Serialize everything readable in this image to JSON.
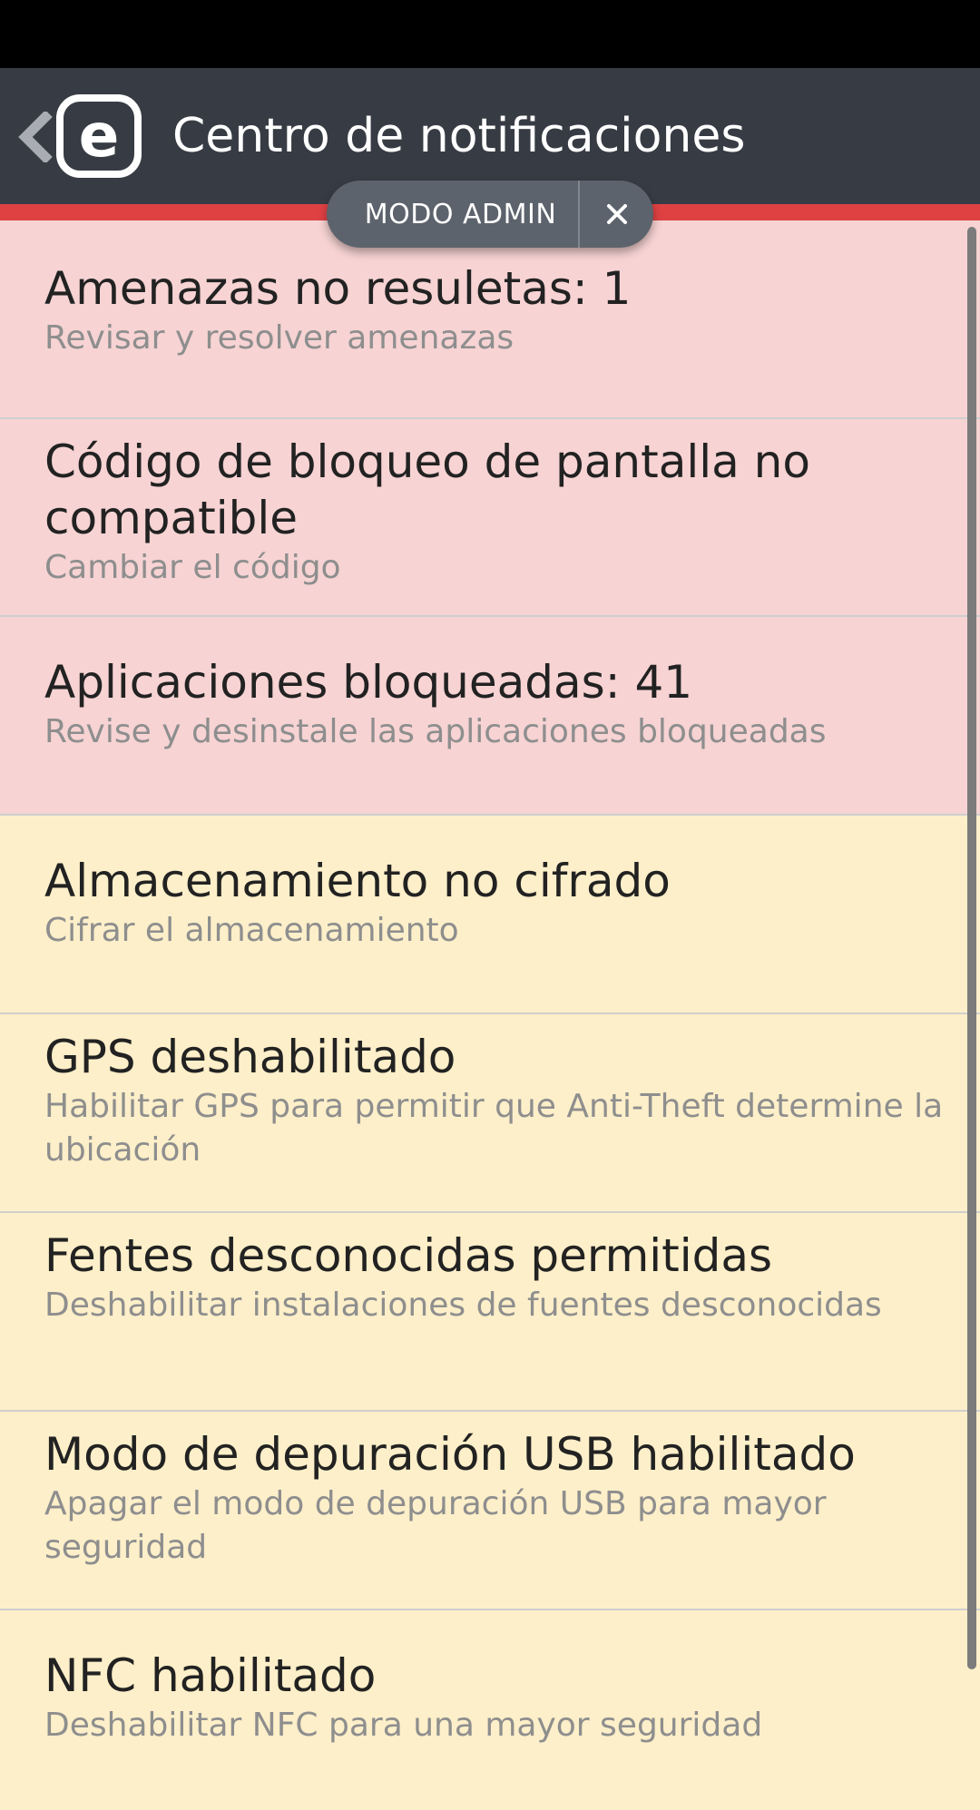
{
  "app_bar": {
    "title": "Centro de notificaciones",
    "back_icon": "chevron-left-icon",
    "logo_icon": "eset-e-logo-icon"
  },
  "admin_mode": {
    "label": "MODO ADMIN",
    "close_icon": "close-icon"
  },
  "colors": {
    "app_bar": "#373c44",
    "alert_strip": "#df4143",
    "critical_bg": "#f7d3d3",
    "warning_bg": "#fdefc9"
  },
  "notifications": [
    {
      "title": "Amenazas no resuletas: 1",
      "subtitle": "Revisar y resolver amenazas",
      "severity": "critical"
    },
    {
      "title": "Código de bloqueo de pantalla no compatible",
      "subtitle": "Cambiar el código",
      "severity": "critical"
    },
    {
      "title": "Aplicaciones bloqueadas: 41",
      "subtitle": "Revise y desinstale las aplicaciones bloqueadas",
      "severity": "critical"
    },
    {
      "title": "Almacenamiento no cifrado",
      "subtitle": "Cifrar el almacenamiento",
      "severity": "warning"
    },
    {
      "title": "GPS deshabilitado",
      "subtitle": "Habilitar GPS para permitir que Anti-Theft determine la ubicación",
      "severity": "warning"
    },
    {
      "title": "Fentes desconocidas permitidas",
      "subtitle": "Deshabilitar instalaciones de fuentes desconocidas",
      "severity": "warning"
    },
    {
      "title": "Modo de depuración USB habilitado",
      "subtitle": "Apagar el modo de depuración USB para mayor seguridad",
      "severity": "warning"
    },
    {
      "title": "NFC habilitado",
      "subtitle": "Deshabilitar NFC para una mayor seguridad",
      "severity": "warning"
    }
  ]
}
